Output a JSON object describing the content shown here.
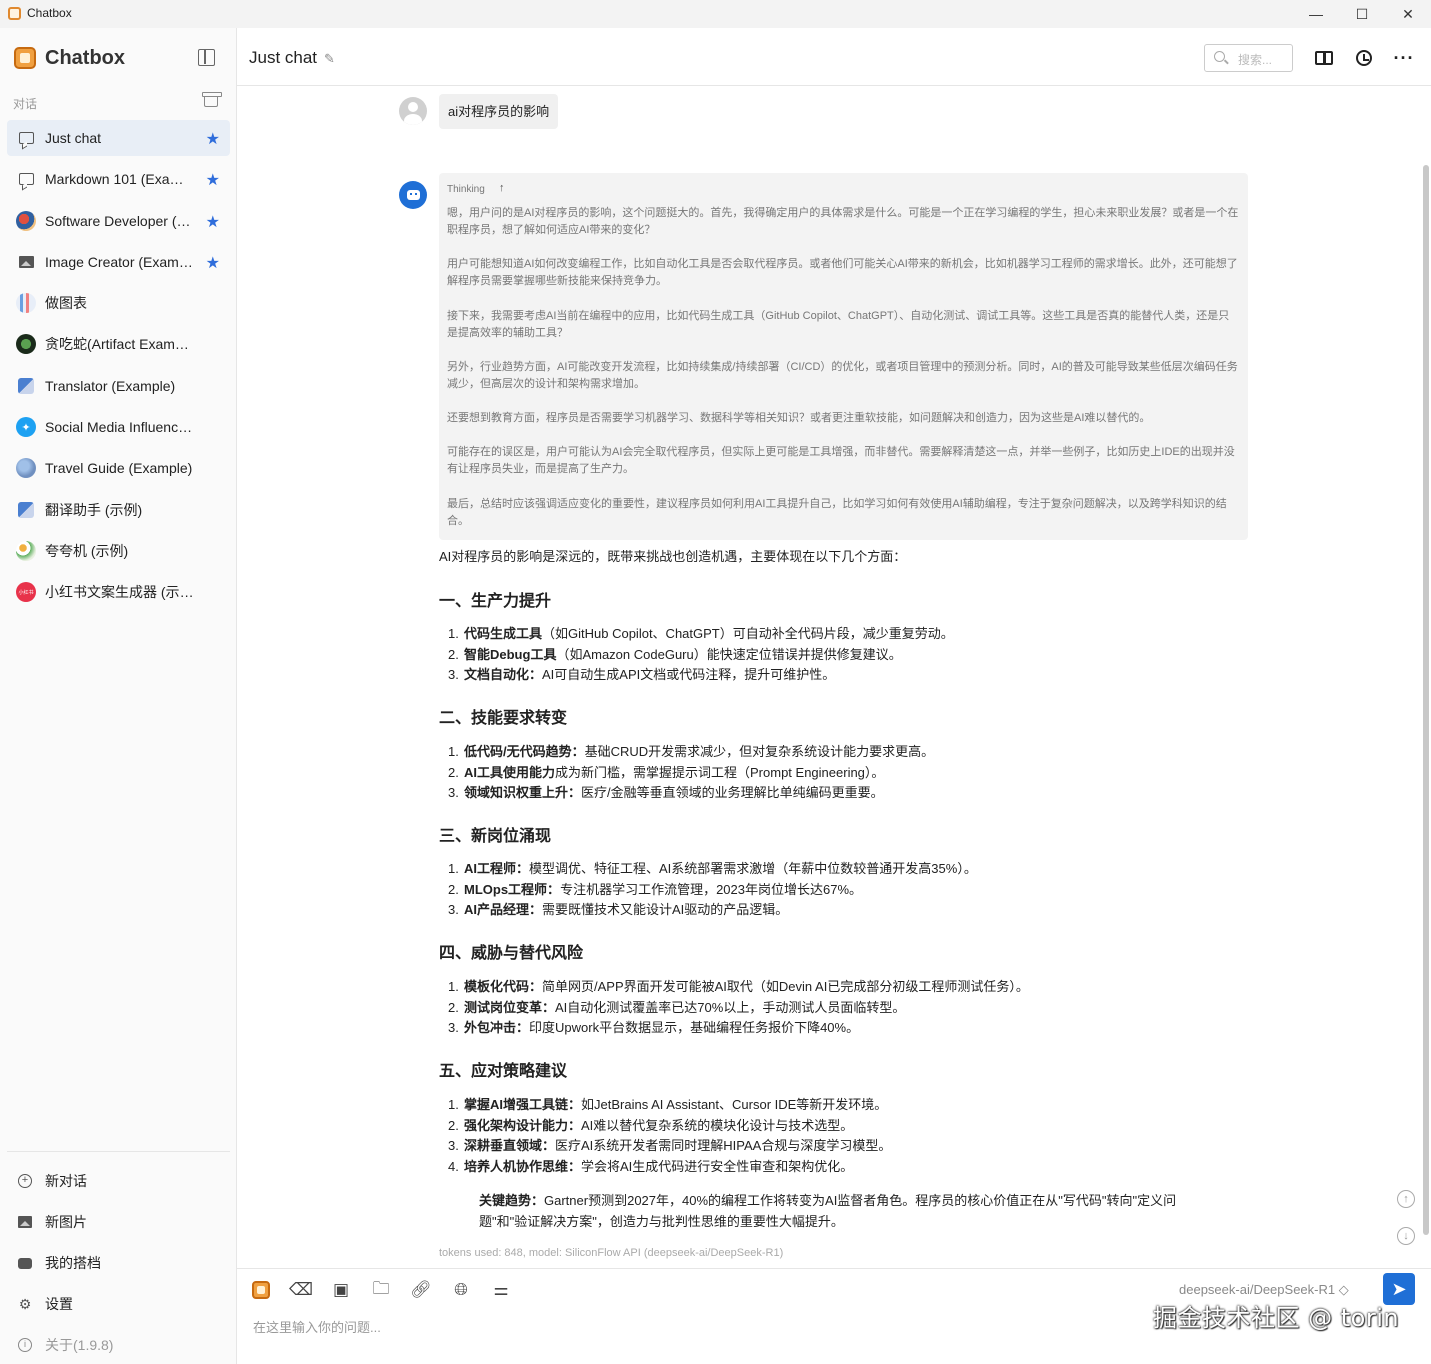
{
  "window": {
    "title": "Chatbox",
    "minimize": "—",
    "maximize": "☐",
    "close": "✕"
  },
  "sidebar": {
    "brand": "Chatbox",
    "section_label": "对话",
    "conversations": [
      {
        "label": "Just chat",
        "icon": "chat-icon",
        "starred": true,
        "active": true
      },
      {
        "label": "Markdown 101 (Example)",
        "icon": "chat-icon",
        "starred": true
      },
      {
        "label": "Software Developer (Example)",
        "icon": "developer-avatar",
        "starred": true
      },
      {
        "label": "Image Creator (Example)",
        "icon": "image-icon",
        "starred": true
      },
      {
        "label": "做图表",
        "icon": "chart-avatar"
      },
      {
        "label": "贪吃蛇(Artifact Example)",
        "icon": "snake-avatar"
      },
      {
        "label": "Translator (Example)",
        "icon": "translator-avatar"
      },
      {
        "label": "Social Media Influencer (Example)",
        "icon": "twitter-avatar"
      },
      {
        "label": "Travel Guide (Example)",
        "icon": "travel-avatar"
      },
      {
        "label": "翻译助手 (示例)",
        "icon": "translator-avatar"
      },
      {
        "label": "夸夸机 (示例)",
        "icon": "praise-avatar"
      },
      {
        "label": "小红书文案生成器 (示例)",
        "icon": "xiaohongshu-avatar",
        "badge": "小红书"
      }
    ],
    "bottom_menu": [
      {
        "label": "新对话",
        "icon": "plus-circle-icon"
      },
      {
        "label": "新图片",
        "icon": "image-add-icon"
      },
      {
        "label": "我的搭档",
        "icon": "robot-icon"
      },
      {
        "label": "设置",
        "icon": "gear-icon"
      },
      {
        "label": "关于(1.9.8)",
        "icon": "info-icon"
      }
    ]
  },
  "header": {
    "title": "Just chat",
    "search_placeholder": "搜索..."
  },
  "messages": {
    "user": "ai对程序员的影响",
    "thinking_label": "Thinking",
    "thinking_paragraphs": [
      "嗯，用户问的是AI对程序员的影响，这个问题挺大的。首先，我得确定用户的具体需求是什么。可能是一个正在学习编程的学生，担心未来职业发展？或者是一个在职程序员，想了解如何适应AI带来的变化？",
      "用户可能想知道AI如何改变编程工作，比如自动化工具是否会取代程序员。或者他们可能关心AI带来的新机会，比如机器学习工程师的需求增长。此外，还可能想了解程序员需要掌握哪些新技能来保持竞争力。",
      "接下来，我需要考虑AI当前在编程中的应用，比如代码生成工具（GitHub Copilot、ChatGPT）、自动化测试、调试工具等。这些工具是否真的能替代人类，还是只是提高效率的辅助工具？",
      "另外，行业趋势方面，AI可能改变开发流程，比如持续集成/持续部署（CI/CD）的优化，或者项目管理中的预测分析。同时，AI的普及可能导致某些低层次编码任务减少，但高层次的设计和架构需求增加。",
      "还要想到教育方面，程序员是否需要学习机器学习、数据科学等相关知识？或者更注重软技能，如问题解决和创造力，因为这些是AI难以替代的。",
      "可能存在的误区是，用户可能认为AI会完全取代程序员，但实际上更可能是工具增强，而非替代。需要解释清楚这一点，并举一些例子，比如历史上IDE的出现并没有让程序员失业，而是提高了生产力。",
      "最后，总结时应该强调适应变化的重要性，建议程序员如何利用AI工具提升自己，比如学习如何有效使用AI辅助编程，专注于复杂问题解决，以及跨学科知识的结合。"
    ],
    "answer": {
      "intro": "AI对程序员的影响是深远的，既带来挑战也创造机遇，主要体现在以下几个方面：",
      "sections": [
        {
          "heading": "一、生产力提升",
          "items": [
            {
              "num": "1.",
              "bold": "代码生成工具",
              "text": "（如GitHub Copilot、ChatGPT）可自动补全代码片段，减少重复劳动。"
            },
            {
              "num": "2.",
              "bold": "智能Debug工具",
              "text": "（如Amazon CodeGuru）能快速定位错误并提供修复建议。"
            },
            {
              "num": "3.",
              "bold": "文档自动化：",
              "text": "AI可自动生成API文档或代码注释，提升可维护性。"
            }
          ]
        },
        {
          "heading": "二、技能要求转变",
          "items": [
            {
              "num": "1.",
              "bold": "低代码/无代码趋势：",
              "text": "基础CRUD开发需求减少，但对复杂系统设计能力要求更高。"
            },
            {
              "num": "2.",
              "bold": "AI工具使用能力",
              "text": "成为新门槛，需掌握提示词工程（Prompt Engineering）。"
            },
            {
              "num": "3.",
              "bold": "领域知识权重上升：",
              "text": "医疗/金融等垂直领域的业务理解比单纯编码更重要。"
            }
          ]
        },
        {
          "heading": "三、新岗位涌现",
          "items": [
            {
              "num": "1.",
              "bold": "AI工程师：",
              "text": "模型调优、特征工程、AI系统部署需求激增（年薪中位数较普通开发高35%）。"
            },
            {
              "num": "2.",
              "bold": "MLOps工程师：",
              "text": "专注机器学习工作流管理，2023年岗位增长达67%。"
            },
            {
              "num": "3.",
              "bold": "AI产品经理：",
              "text": "需要既懂技术又能设计AI驱动的产品逻辑。"
            }
          ]
        },
        {
          "heading": "四、威胁与替代风险",
          "items": [
            {
              "num": "1.",
              "bold": "模板化代码：",
              "text": "简单网页/APP界面开发可能被AI取代（如Devin AI已完成部分初级工程师测试任务）。"
            },
            {
              "num": "2.",
              "bold": "测试岗位变革：",
              "text": "AI自动化测试覆盖率已达70%以上，手动测试人员面临转型。"
            },
            {
              "num": "3.",
              "bold": "外包冲击：",
              "text": "印度Upwork平台数据显示，基础编程任务报价下降40%。"
            }
          ]
        },
        {
          "heading": "五、应对策略建议",
          "items": [
            {
              "num": "1.",
              "bold": "掌握AI增强工具链：",
              "text": "如JetBrains AI Assistant、Cursor IDE等新开发环境。"
            },
            {
              "num": "2.",
              "bold": "强化架构设计能力：",
              "text": "AI难以替代复杂系统的模块化设计与技术选型。"
            },
            {
              "num": "3.",
              "bold": "深耕垂直领域：",
              "text": "医疗AI系统开发者需同时理解HIPAA合规与深度学习模型。"
            },
            {
              "num": "4.",
              "bold": "培养人机协作思维：",
              "text": "学会将AI生成代码进行安全性审查和架构优化。"
            }
          ]
        }
      ],
      "quote_bold": "关键趋势：",
      "quote_text": "Gartner预测到2027年，40%的编程工作将转变为AI监督者角色。程序员的核心价值正在从\"写代码\"转向\"定义问题\"和\"验证解决方案\"，创造力与批判性思维的重要性大幅提升。"
    },
    "tokens": "tokens used: 848, model: SiliconFlow API (deepseek-ai/DeepSeek-R1)"
  },
  "input": {
    "placeholder": "在这里输入你的问题...",
    "model": "deepseek-ai/DeepSeek-R1 ◇",
    "watermark": "掘金技术社区 @ torin"
  },
  "colors": {
    "accent": "#1f6fd6",
    "star": "#2f6ddb",
    "active_bg": "#e8eef6"
  }
}
